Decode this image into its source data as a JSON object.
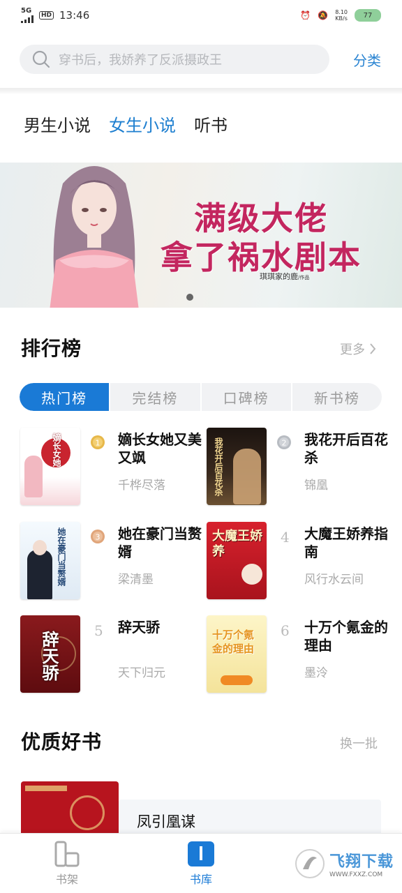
{
  "status_bar": {
    "network": "5G",
    "hd": "HD",
    "time": "13:46",
    "speed": "8.10\nKB/s",
    "battery": "77"
  },
  "search": {
    "placeholder": "穿书后，我娇养了反派摄政王",
    "category_link": "分类"
  },
  "channels": [
    {
      "label": "男生小说",
      "active": false
    },
    {
      "label": "女生小说",
      "active": true
    },
    {
      "label": "听书",
      "active": false
    }
  ],
  "banner": {
    "title_line1": "满级大佬",
    "title_line2": "拿了祸水剧本",
    "author": "琪琪家的鹿",
    "author_suffix": "/作品"
  },
  "ranking": {
    "title": "排行榜",
    "more_label": "更多",
    "tabs": [
      {
        "label": "热门榜",
        "active": true
      },
      {
        "label": "完结榜",
        "active": false
      },
      {
        "label": "口碑榜",
        "active": false
      },
      {
        "label": "新书榜",
        "active": false
      }
    ],
    "items": [
      {
        "rank": "1",
        "title": "嫡长女她又美又飒",
        "author": "千桦尽落",
        "cover_text": "嫡长女她",
        "cover_color": "#ffffff",
        "badge_color": "#e7b84a"
      },
      {
        "rank": "2",
        "title": "我花开后百花杀",
        "author": "锦凰",
        "cover_text": "我花开后百花杀",
        "cover_color": "#2b1d16",
        "badge_color": "#b8bcc2"
      },
      {
        "rank": "3",
        "title": "她在豪门当赘婿",
        "author": "梁清墨",
        "cover_text": "她在豪门当赘婿",
        "cover_color": "#eaf3fb",
        "badge_color": "#e0a57a"
      },
      {
        "rank": "4",
        "title": "大魔王娇养指南",
        "author": "风行水云间",
        "cover_text": "大魔王娇养",
        "cover_color": "#c91d28",
        "badge_color": ""
      },
      {
        "rank": "5",
        "title": "辞天骄",
        "author": "天下归元",
        "cover_text": "辞天骄",
        "cover_color": "#7a1216",
        "badge_color": ""
      },
      {
        "rank": "6",
        "title": "十万个氪金的理由",
        "author": "墨泠",
        "cover_text": "十万个氪金的理由",
        "cover_color": "#fbf1b6",
        "badge_color": ""
      }
    ]
  },
  "quality": {
    "title": "优质好书",
    "refresh_label": "换一批",
    "first_book_title": "凤引凰谋"
  },
  "bottom_nav": [
    {
      "label": "书架",
      "active": false,
      "icon": "bookshelf-icon"
    },
    {
      "label": "书库",
      "active": true,
      "icon": "library-icon"
    }
  ],
  "watermark": {
    "text": "飞翔下载",
    "sub": "WWW.FXXZ.COM"
  },
  "colors": {
    "accent": "#1a7ad6",
    "banner_title": "#c3265f"
  }
}
